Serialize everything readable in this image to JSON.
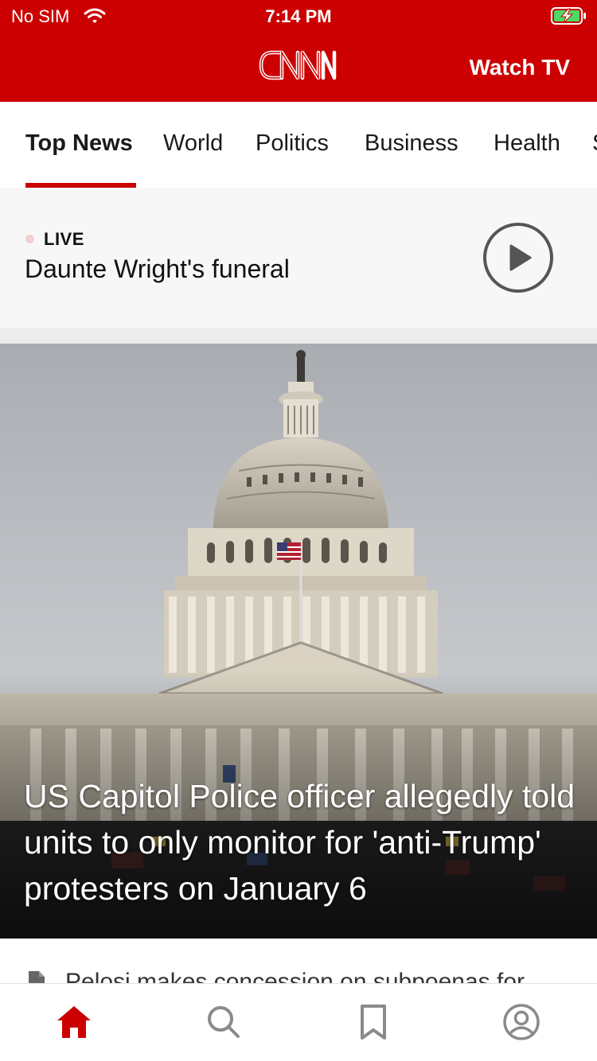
{
  "status_bar": {
    "carrier": "No SIM",
    "time": "7:14 PM",
    "wifi_icon": "wifi-icon",
    "battery_icon": "battery-charging-icon"
  },
  "header": {
    "brand_color": "#cc0000",
    "logo_icon": "cnn-logo",
    "watch_tv_label": "Watch TV"
  },
  "tabs": [
    {
      "label": "Top News",
      "active": true
    },
    {
      "label": "World"
    },
    {
      "label": "Politics"
    },
    {
      "label": "Business"
    },
    {
      "label": "Health"
    },
    {
      "label": "S"
    }
  ],
  "live": {
    "badge": "LIVE",
    "title": "Daunte Wright's funeral",
    "play_icon": "play-circle-icon"
  },
  "hero": {
    "image": "us-capitol-photo",
    "headline": "US Capitol Police officer allegedly told units to only monitor for 'anti-Trump' protesters on January 6"
  },
  "next_story": {
    "icon": "document-icon",
    "title": "Pelosi makes concession on subpoenas for"
  },
  "bottom_nav": {
    "items": [
      {
        "name": "home",
        "icon": "home-icon",
        "active": true
      },
      {
        "name": "search",
        "icon": "search-icon"
      },
      {
        "name": "saved",
        "icon": "bookmark-icon"
      },
      {
        "name": "profile",
        "icon": "profile-icon"
      }
    ],
    "active_color": "#cc0000",
    "inactive_color": "#8a8a8a"
  }
}
